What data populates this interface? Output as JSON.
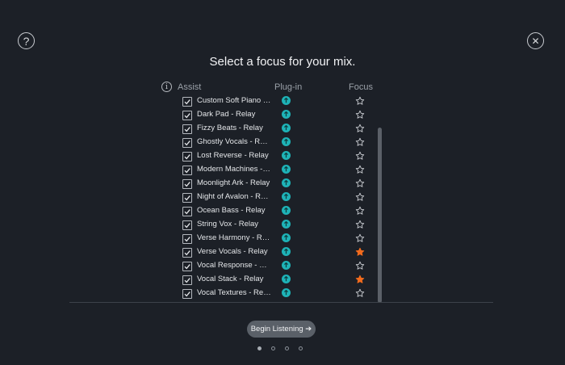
{
  "header": {
    "title": "Select a focus for your mix.",
    "help_icon": "question-icon",
    "close_icon": "close-icon"
  },
  "columns": {
    "assist": "Assist",
    "plugin": "Plug-in",
    "focus": "Focus"
  },
  "tracks": [
    {
      "name": "Custom Soft Piano - ...",
      "checked": true,
      "focused": false
    },
    {
      "name": "Dark Pad - Relay",
      "checked": true,
      "focused": false
    },
    {
      "name": "Fizzy Beats - Relay",
      "checked": true,
      "focused": false
    },
    {
      "name": "Ghostly Vocals - Relay",
      "checked": true,
      "focused": false
    },
    {
      "name": "Lost Reverse - Relay",
      "checked": true,
      "focused": false
    },
    {
      "name": "Modern Machines - R...",
      "checked": true,
      "focused": false
    },
    {
      "name": "Moonlight Ark - Relay",
      "checked": true,
      "focused": false
    },
    {
      "name": "Night of Avalon - Relay",
      "checked": true,
      "focused": false
    },
    {
      "name": "Ocean Bass - Relay",
      "checked": true,
      "focused": false
    },
    {
      "name": "String Vox - Relay",
      "checked": true,
      "focused": false
    },
    {
      "name": "Verse Harmony - Relay",
      "checked": true,
      "focused": false
    },
    {
      "name": "Verse Vocals - Relay",
      "checked": true,
      "focused": true
    },
    {
      "name": "Vocal Response - Relay",
      "checked": true,
      "focused": false
    },
    {
      "name": "Vocal Stack - Relay",
      "checked": true,
      "focused": true
    },
    {
      "name": "Vocal Textures - Relay",
      "checked": true,
      "focused": false
    }
  ],
  "footer": {
    "begin_label": "Begin Listening ➔",
    "pages": 4,
    "current_page": 1
  },
  "colors": {
    "background": "#1c2027",
    "plugin_accent": "#1eb3b7",
    "focus_star_active": "#f26b1d",
    "button_bg": "#5a6068"
  }
}
